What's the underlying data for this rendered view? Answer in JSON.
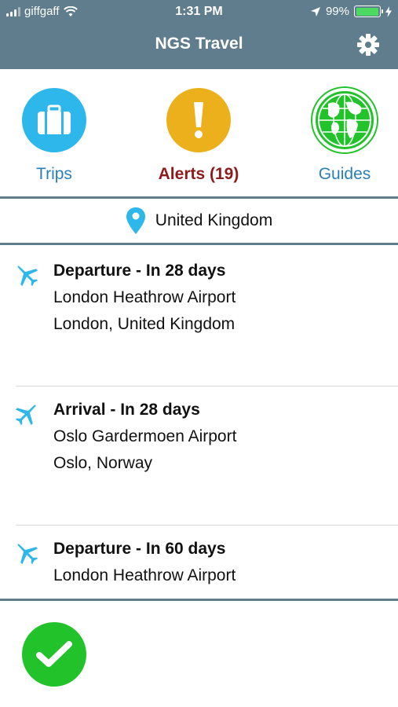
{
  "status_bar": {
    "carrier": "giffgaff",
    "time": "1:31 PM",
    "battery": "99%",
    "battery_level": 0.99,
    "icons": [
      "signal-icon",
      "wifi-icon",
      "location-arrow-icon",
      "battery-icon",
      "charging-icon"
    ]
  },
  "nav": {
    "title": "NGS Travel",
    "settings_icon": "gear-icon"
  },
  "tiles": {
    "trips": {
      "label": "Trips",
      "icon": "suitcase-icon",
      "color": "#2db7ea"
    },
    "alerts": {
      "label": "Alerts (19)",
      "icon": "exclamation-icon",
      "color": "#ecb01c"
    },
    "guides": {
      "label": "Guides",
      "icon": "globe-icon",
      "color": "#22c32a"
    }
  },
  "location": {
    "icon": "map-pin-icon",
    "label": "United Kingdom"
  },
  "trips": [
    {
      "title": "Departure - In 28 days",
      "airport": "London Heathrow Airport",
      "city": "London, United Kingdom",
      "icon": "plane-departure-icon"
    },
    {
      "title": "Arrival - In 28 days",
      "airport": "Oslo Gardermoen Airport",
      "city": "Oslo, Norway",
      "icon": "plane-arrival-icon"
    },
    {
      "title": "Departure - In 60 days",
      "airport": "London Heathrow Airport",
      "city": "",
      "icon": "plane-departure-icon"
    }
  ],
  "bottom": {
    "confirm_icon": "checkmark-icon"
  },
  "colors": {
    "header": "#5f7d8c",
    "link": "#2a7fb8",
    "alert_text": "#8c1b1b",
    "accent_blue": "#2db7ea",
    "accent_green": "#22c32a"
  }
}
